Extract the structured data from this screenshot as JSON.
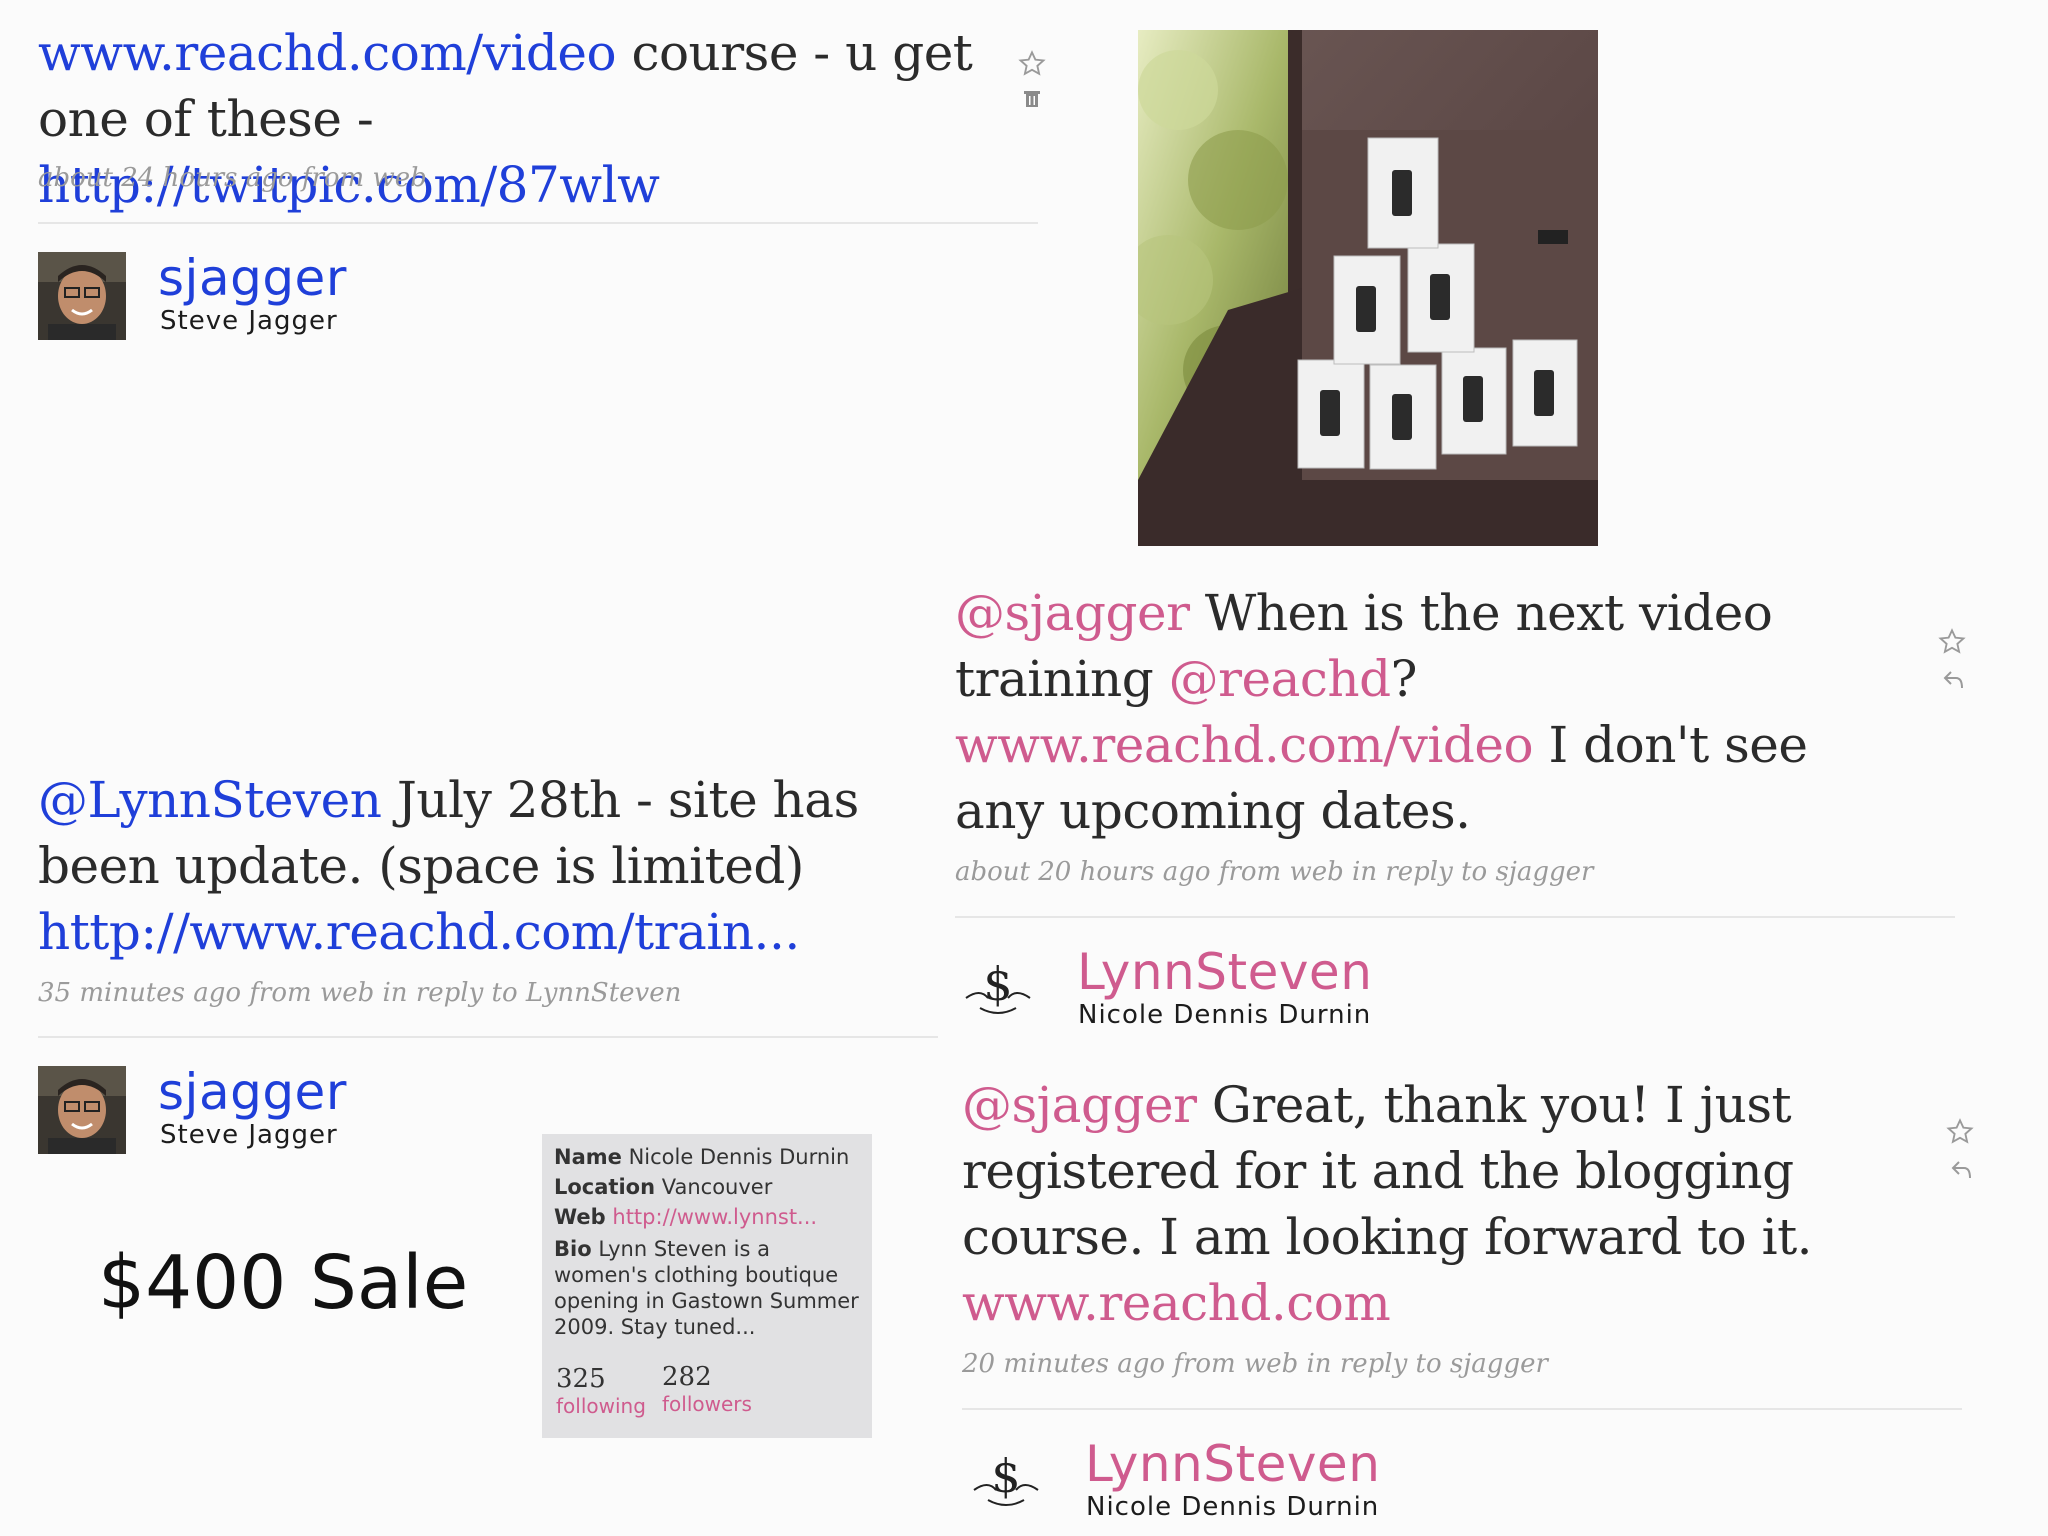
{
  "tweet1": {
    "url1": "www.reachd.com/video",
    "text1": " course - u get one of these - ",
    "url2": "http://twitpic.com/87wlw",
    "meta": "about 24 hours ago from web"
  },
  "user_sjagger_1": {
    "username": "sjagger",
    "fullname": "Steve Jagger"
  },
  "tweet2": {
    "mention": "@LynnSteven",
    "text": " July 28th - site has been update. (space is limited) ",
    "url": "http://www.reachd.com/train...",
    "meta": "35 minutes ago from web in reply to LynnSteven"
  },
  "user_sjagger_2": {
    "username": "sjagger",
    "fullname": "Steve Jagger"
  },
  "sale_label": "$400 Sale",
  "profile_card": {
    "name_label": "Name",
    "name_value": "Nicole Dennis Durnin",
    "location_label": "Location",
    "location_value": "Vancouver",
    "web_label": "Web",
    "web_value": "http://www.lynnst...",
    "bio_label": "Bio",
    "bio_value": "Lynn Steven is a women's clothing boutique opening in Gastown Summer 2009. Stay tuned...",
    "following_count": "325",
    "following_label": "following",
    "followers_count": "282",
    "followers_label": "followers"
  },
  "tweet3": {
    "mention1": "@sjagger",
    "text1": " When is the next video training ",
    "mention2": "@reachd",
    "text2": "? ",
    "url": "www.reachd.com/video",
    "text3": " I don't see any upcoming dates.",
    "meta": "about 20 hours ago from web in reply to sjagger"
  },
  "user_lynn_1": {
    "username": "LynnSteven",
    "fullname": "Nicole Dennis Durnin"
  },
  "tweet4": {
    "mention": "@sjagger",
    "text": " Great, thank you! I just registered for it and the blogging course. I am looking forward to it. ",
    "url": "www.reachd.com",
    "meta": "20 minutes ago from web in reply to sjagger"
  },
  "user_lynn_2": {
    "username": "LynnSteven",
    "fullname": "Nicole Dennis Durnin"
  },
  "colors": {
    "link_blue": "#1f3fd9",
    "link_pink": "#cf5b8e",
    "meta_gray": "#9a9a9a"
  },
  "icons": [
    "star-icon",
    "trash-icon",
    "reply-icon",
    "dollar-logo-icon",
    "avatar"
  ]
}
